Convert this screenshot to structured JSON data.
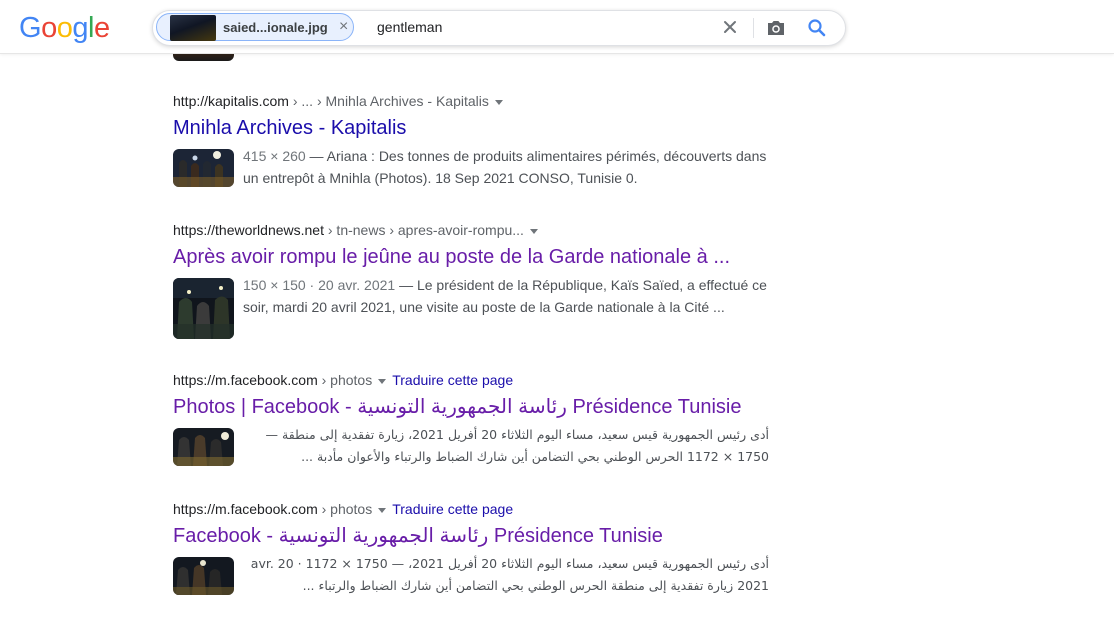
{
  "header": {
    "logo_letters": [
      {
        "char": "G",
        "color": "#4285F4"
      },
      {
        "char": "o",
        "color": "#EA4335"
      },
      {
        "char": "o",
        "color": "#FBBC05"
      },
      {
        "char": "g",
        "color": "#4285F4"
      },
      {
        "char": "l",
        "color": "#34A853"
      },
      {
        "char": "e",
        "color": "#EA4335"
      }
    ],
    "image_chip_name": "saied...ionale.jpg",
    "query": "gentleman",
    "icons": [
      "close-icon",
      "clear-icon",
      "camera-icon",
      "search-icon"
    ]
  },
  "results": [
    {
      "cite_domain": "http://kapitalis.com",
      "cite_path": " › ... › Mnihla Archives - Kapitalis",
      "title": "Mnihla Archives - Kapitalis",
      "visited": false,
      "snippet_meta": "415 × 260",
      "snippet": " — Ariana : Des tonnes de produits alimentaires périmés, découverts dans un entrepôt à Mnihla (Photos). 18 Sep 2021 CONSO, Tunisie 0."
    },
    {
      "cite_domain": "https://theworldnews.net",
      "cite_path": " › tn-news › apres-avoir-rompu...",
      "title": "Après avoir rompu le jeûne au poste de la Garde nationale à ...",
      "visited": true,
      "snippet_meta": "150 × 150 · 20 avr. 2021",
      "snippet": " — Le président de la République, Kaïs Saïed, a effectué ce soir, mardi 20 avril 2021, une visite au poste de la Garde nationale à la Cité ..."
    },
    {
      "cite_domain": "https://m.facebook.com",
      "cite_path": " › photos",
      "translate": "Traduire cette page",
      "title": "Photos | Facebook - رئاسة الجمهورية التونسية Présidence Tunisie",
      "visited": true,
      "snippet_meta": "1750 × 1172",
      "snippet": "أدى رئيس الجمهورية قيس سعيد، مساء اليوم الثلاثاء 20 أفريل 2021، زيارة تفقدية إلى منطقة — 1750 × 1172 الحرس الوطني بحي التضامن أين شارك الضباط والرتباء والأعوان مأدبة ..."
    },
    {
      "cite_domain": "https://m.facebook.com",
      "cite_path": " › photos",
      "translate": "Traduire cette page",
      "title": "Facebook - رئاسة الجمهورية التونسية Présidence Tunisie",
      "visited": true,
      "snippet_meta": "1750 × 1172 · 20 avr. 2021",
      "snippet": "أدى رئيس الجمهورية قيس سعيد، مساء اليوم الثلاثاء 20 أفريل 2021، — 1750 × 1172 · 20 avr. 2021 زيارة تفقدية إلى منطقة الحرس الوطني بحي التضامن أين شارك الضباط والرتباء ..."
    }
  ],
  "colors": {
    "link": "#1a0dab",
    "visited": "#681da8",
    "snippet": "#4d5156"
  }
}
